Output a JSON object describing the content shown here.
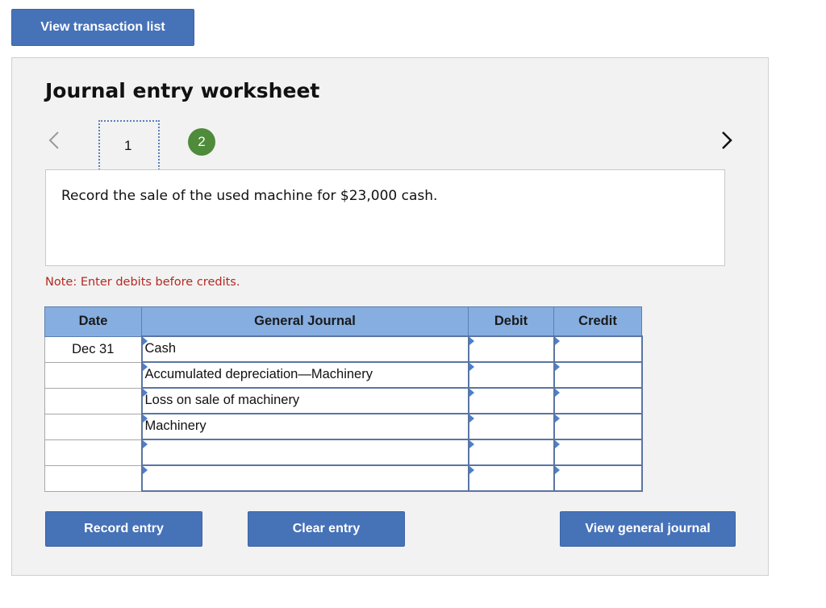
{
  "top_button": "View transaction list",
  "worksheet": {
    "title": "Journal entry worksheet",
    "steps": [
      "1",
      "2"
    ],
    "description": "Record the sale of the used machine for $23,000 cash.",
    "note": "Note: Enter debits before credits."
  },
  "table": {
    "headers": {
      "date": "Date",
      "journal": "General Journal",
      "debit": "Debit",
      "credit": "Credit"
    },
    "rows": [
      {
        "date": "Dec 31",
        "account": "Cash",
        "debit": "",
        "credit": ""
      },
      {
        "date": "",
        "account": "Accumulated depreciation—Machinery",
        "debit": "",
        "credit": ""
      },
      {
        "date": "",
        "account": "Loss on sale of machinery",
        "debit": "",
        "credit": ""
      },
      {
        "date": "",
        "account": "Machinery",
        "debit": "",
        "credit": ""
      },
      {
        "date": "",
        "account": "",
        "debit": "",
        "credit": ""
      },
      {
        "date": "",
        "account": "",
        "debit": "",
        "credit": ""
      }
    ]
  },
  "buttons": {
    "record": "Record entry",
    "clear": "Clear entry",
    "view_general_journal": "View general journal"
  },
  "icons": {
    "prev": "chevron-left-icon",
    "next": "chevron-right-icon",
    "cell_marker": "triangle-marker-icon"
  },
  "colors": {
    "button": "#4672b8",
    "header": "#86aee0",
    "step_active": "#4e8b3a",
    "note": "#b22a22"
  }
}
